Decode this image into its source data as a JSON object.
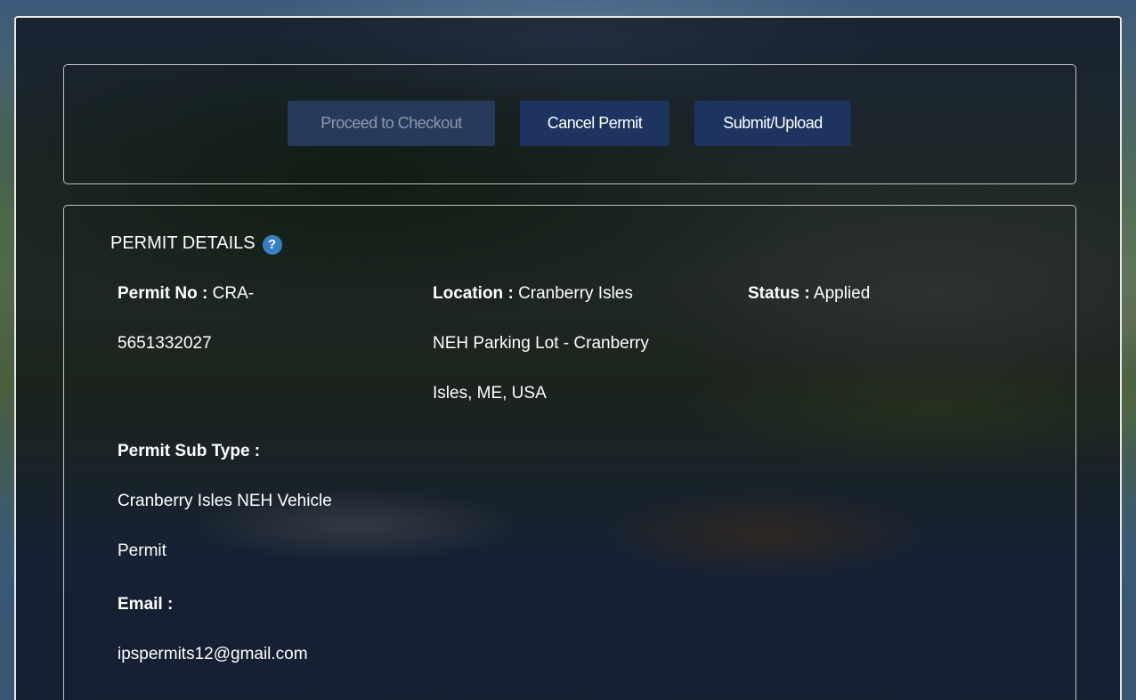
{
  "actions": {
    "checkout_label": "Proceed to Checkout",
    "cancel_label": "Cancel Permit",
    "submit_label": "Submit/Upload"
  },
  "details": {
    "title": "PERMIT DETAILS",
    "help_icon": "?",
    "permit_no": {
      "label": "Permit No :",
      "value_line1": "CRA-",
      "value_line2": "5651332027"
    },
    "location": {
      "label": "Location :",
      "value_line1": "Cranberry Isles",
      "value_line2": "NEH Parking Lot - Cranberry",
      "value_line3": "Isles, ME, USA"
    },
    "status": {
      "label": "Status :",
      "value": "Applied"
    },
    "sub_type": {
      "label": "Permit Sub Type :",
      "value_line1": "Cranberry Isles NEH Vehicle",
      "value_line2": "Permit"
    },
    "email": {
      "label": "Email :",
      "value": "ipspermits12@gmail.com"
    }
  },
  "colors": {
    "button_primary": "#1d3461",
    "button_disabled": "#273a5c",
    "help_icon": "#3a7fc4",
    "overlay": "rgba(0,0,10,0.62)"
  }
}
